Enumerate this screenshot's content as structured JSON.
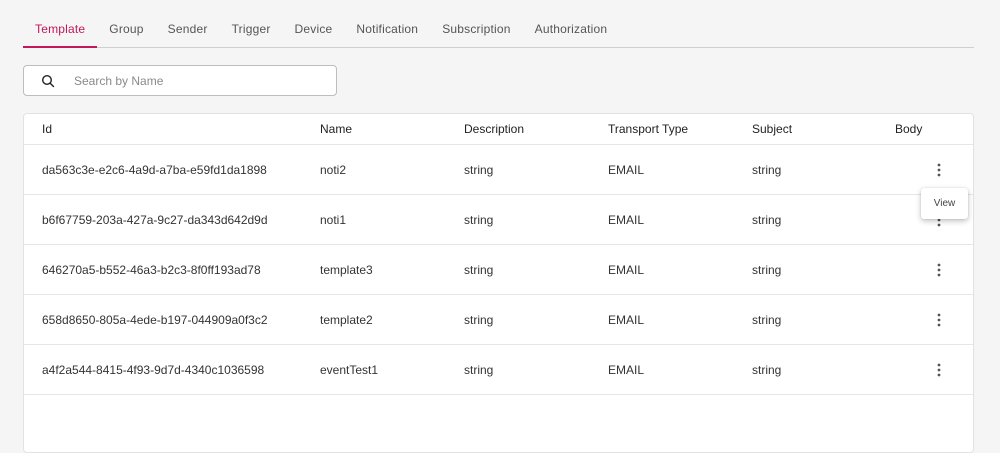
{
  "tabs": [
    {
      "label": "Template",
      "active": true
    },
    {
      "label": "Group",
      "active": false
    },
    {
      "label": "Sender",
      "active": false
    },
    {
      "label": "Trigger",
      "active": false
    },
    {
      "label": "Device",
      "active": false
    },
    {
      "label": "Notification",
      "active": false
    },
    {
      "label": "Subscription",
      "active": false
    },
    {
      "label": "Authorization",
      "active": false
    }
  ],
  "search": {
    "placeholder": "Search by Name",
    "value": "",
    "icon": "search-icon"
  },
  "table": {
    "headers": {
      "id": "Id",
      "name": "Name",
      "description": "Description",
      "transport_type": "Transport Type",
      "subject": "Subject",
      "body": "Body"
    },
    "rows": [
      {
        "id": "da563c3e-e2c6-4a9d-a7ba-e59fd1da1898",
        "name": "noti2",
        "description": "string",
        "transport_type": "EMAIL",
        "subject": "string"
      },
      {
        "id": "b6f67759-203a-427a-9c27-da343d642d9d",
        "name": "noti1",
        "description": "string",
        "transport_type": "EMAIL",
        "subject": "string"
      },
      {
        "id": "646270a5-b552-46a3-b2c3-8f0ff193ad78",
        "name": "template3",
        "description": "string",
        "transport_type": "EMAIL",
        "subject": "string"
      },
      {
        "id": "658d8650-805a-4ede-b197-044909a0f3c2",
        "name": "template2",
        "description": "string",
        "transport_type": "EMAIL",
        "subject": "string"
      },
      {
        "id": "a4f2a544-8415-4f93-9d7d-4340c1036598",
        "name": "eventTest1",
        "description": "string",
        "transport_type": "EMAIL",
        "subject": "string"
      }
    ]
  },
  "row_menu": {
    "label": "View",
    "icon": "more-vert-icon"
  },
  "colors": {
    "accent": "#c2185b",
    "background": "#f5f5f5",
    "card": "#ffffff"
  }
}
